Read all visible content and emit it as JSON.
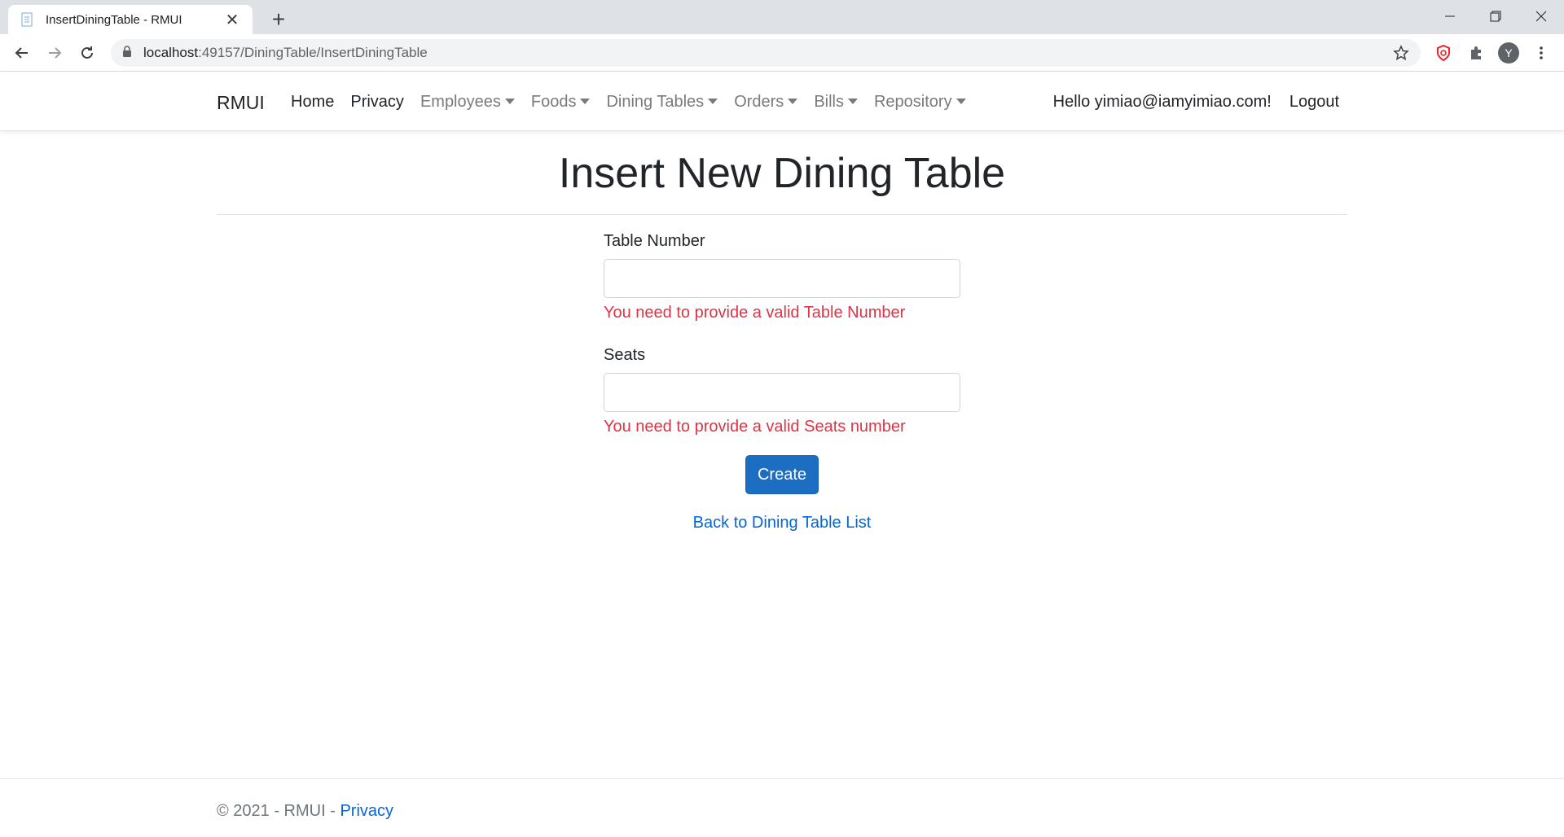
{
  "browser": {
    "tab_title": "InsertDiningTable - RMUI",
    "url_host": "localhost",
    "url_path": ":49157/DiningTable/InsertDiningTable",
    "avatar_letter": "Y"
  },
  "nav": {
    "brand": "RMUI",
    "links": [
      "Home",
      "Privacy"
    ],
    "dropdowns": [
      "Employees",
      "Foods",
      "Dining Tables",
      "Orders",
      "Bills",
      "Repository"
    ],
    "greeting": "Hello yimiao@iamyimiao.com!",
    "logout": "Logout"
  },
  "page": {
    "title": "Insert New Dining Table",
    "fields": [
      {
        "label": "Table Number",
        "value": "",
        "error": "You need to provide a valid Table Number"
      },
      {
        "label": "Seats",
        "value": "",
        "error": "You need to provide a valid Seats number"
      }
    ],
    "create_label": "Create",
    "back_link": "Back to Dining Table List"
  },
  "footer": {
    "text": "© 2021 - RMUI - ",
    "privacy": "Privacy"
  },
  "colors": {
    "primary": "#1b6ec2",
    "link": "#0366d6",
    "error": "#dc3545"
  }
}
